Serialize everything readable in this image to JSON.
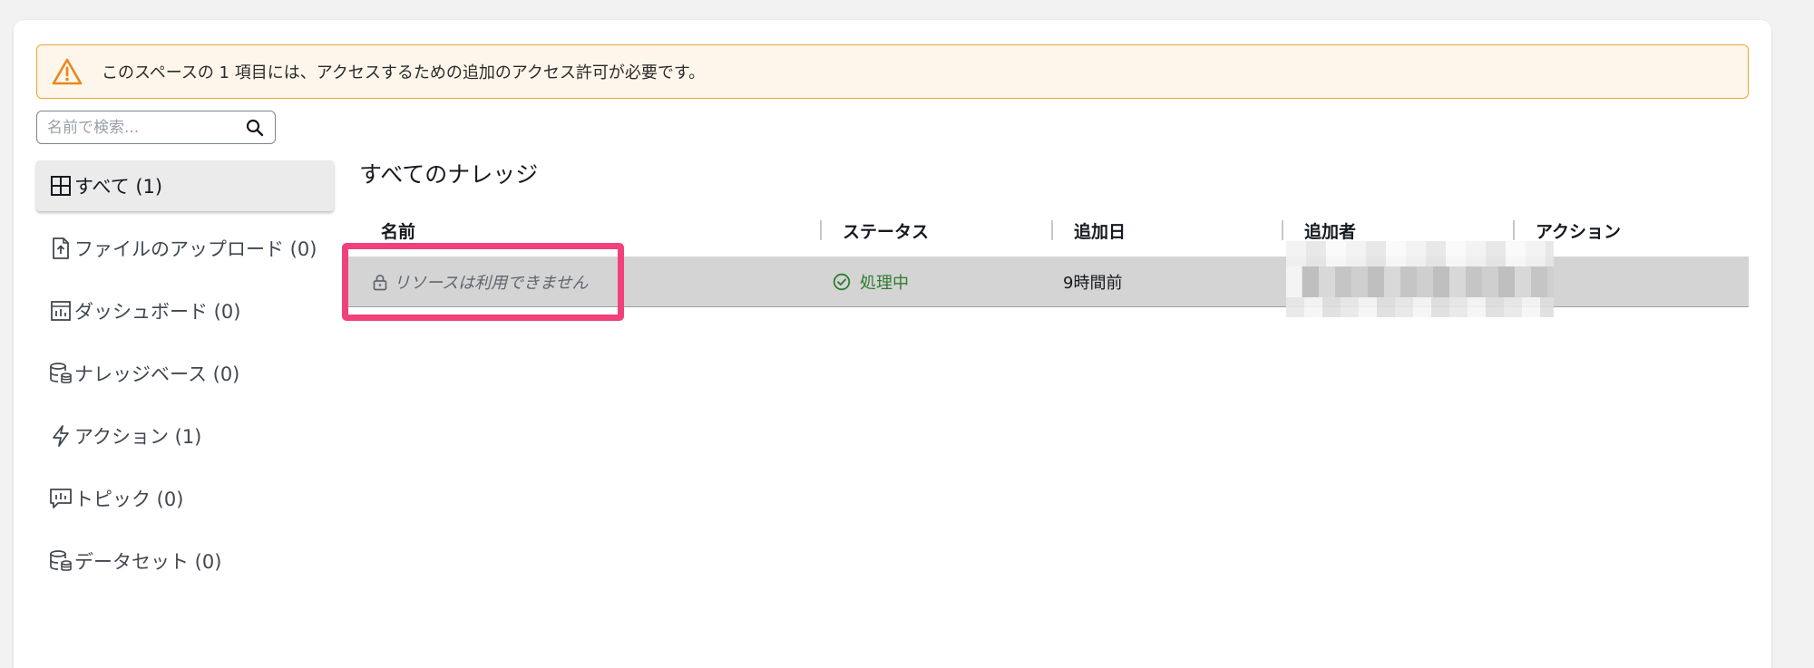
{
  "alert": {
    "message": "このスペースの 1 項目には、アクセスするための追加のアクセス許可が必要です。",
    "icon": "warning-icon"
  },
  "search": {
    "placeholder": "名前で検索..."
  },
  "sidebar": {
    "items": [
      {
        "label": "すべて (1)",
        "icon": "grid-icon",
        "active": true
      },
      {
        "label": "ファイルのアップロード (0)",
        "icon": "file-upload-icon"
      },
      {
        "label": "ダッシュボード (0)",
        "icon": "dashboard-icon"
      },
      {
        "label": "ナレッジベース (0)",
        "icon": "database-icon"
      },
      {
        "label": "アクション (1)",
        "icon": "lightning-icon"
      },
      {
        "label": "トピック (0)",
        "icon": "topic-chat-icon"
      },
      {
        "label": "データセット (0)",
        "icon": "dataset-icon"
      }
    ]
  },
  "main": {
    "title": "すべてのナレッジ",
    "columns": [
      "名前",
      "ステータス",
      "追加日",
      "追加者",
      "アクション"
    ],
    "rows": [
      {
        "name": "リソースは利用できません",
        "status": "処理中",
        "added_date": "9時間前"
      }
    ]
  },
  "colors": {
    "alert_border": "#f0a436",
    "alert_background": "#fef6ea",
    "status_green": "#2d7d2d",
    "highlight": "#f0417a"
  }
}
